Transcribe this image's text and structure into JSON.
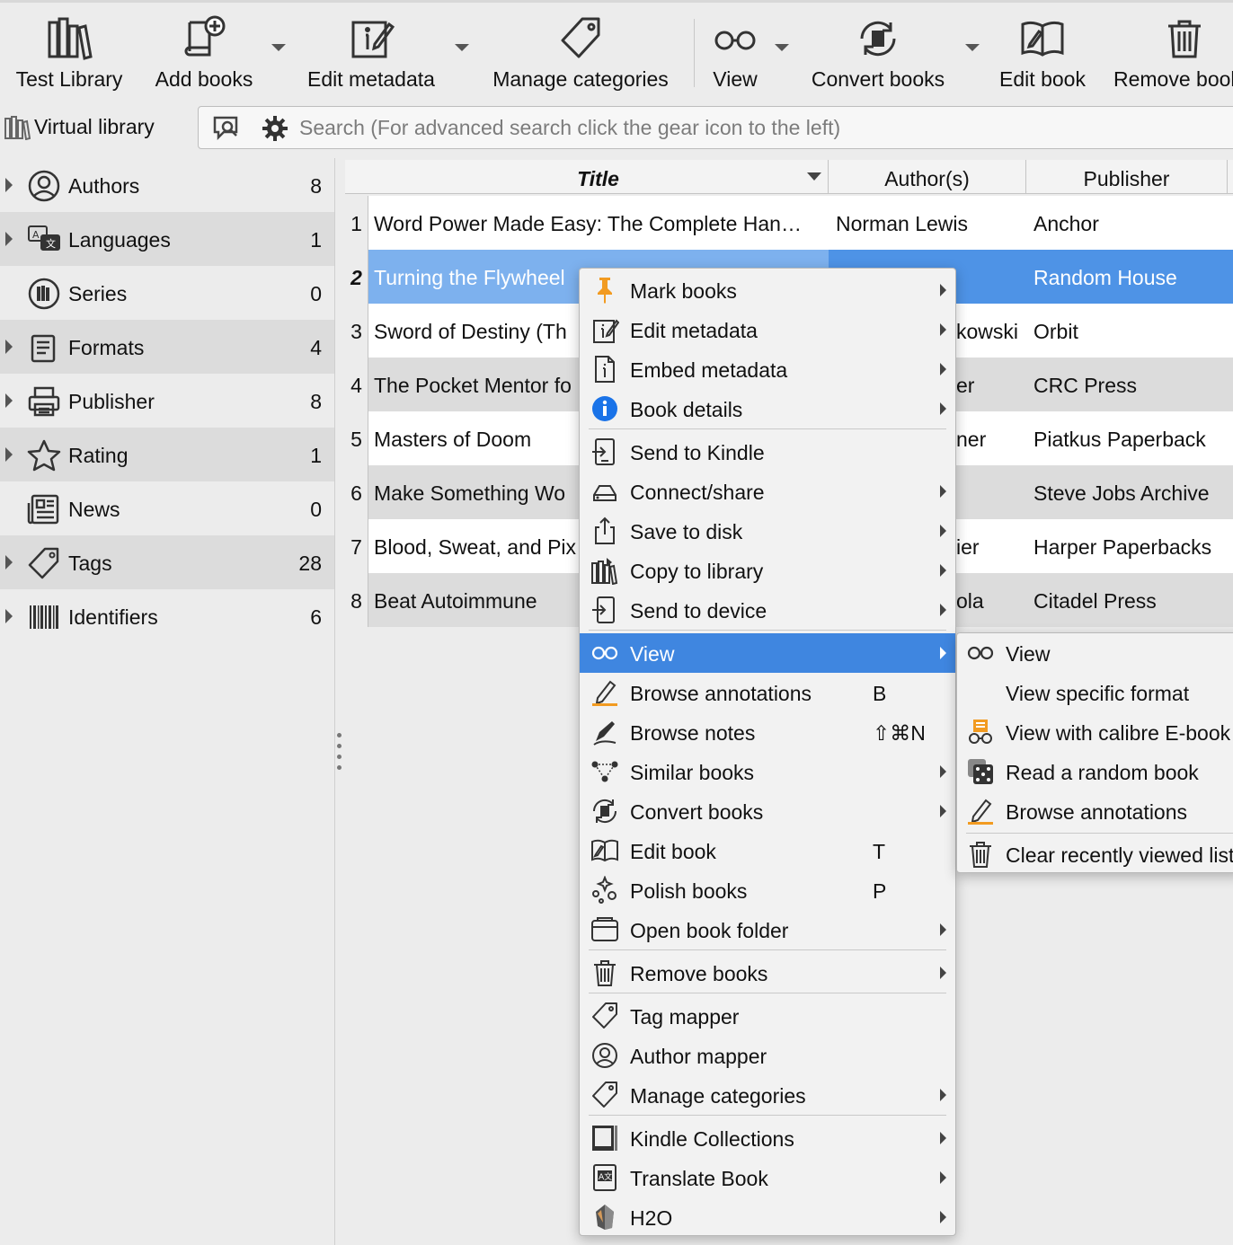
{
  "toolbar": {
    "items": [
      {
        "label": "Test Library",
        "icon": "library-icon"
      },
      {
        "label": "Add books",
        "icon": "add-book-icon"
      },
      {
        "label": "Edit metadata",
        "icon": "edit-metadata-icon"
      },
      {
        "label": "Manage categories",
        "icon": "tag-icon"
      },
      {
        "label": "View",
        "icon": "glasses-icon"
      },
      {
        "label": "Convert books",
        "icon": "convert-icon"
      },
      {
        "label": "Edit book",
        "icon": "edit-book-icon"
      },
      {
        "label": "Remove books",
        "icon": "trash-icon"
      }
    ]
  },
  "search": {
    "virtual_library_label": "Virtual library",
    "placeholder": "Search (For advanced search click the gear icon to the left)"
  },
  "sidebar": {
    "items": [
      {
        "label": "Authors",
        "count": "8",
        "icon": "user-circle-icon"
      },
      {
        "label": "Languages",
        "count": "1",
        "icon": "language-icon"
      },
      {
        "label": "Series",
        "count": "0",
        "icon": "series-icon"
      },
      {
        "label": "Formats",
        "count": "4",
        "icon": "formats-icon"
      },
      {
        "label": "Publisher",
        "count": "8",
        "icon": "publisher-icon"
      },
      {
        "label": "Rating",
        "count": "1",
        "icon": "star-icon"
      },
      {
        "label": "News",
        "count": "0",
        "icon": "news-icon"
      },
      {
        "label": "Tags",
        "count": "28",
        "icon": "tag-icon"
      },
      {
        "label": "Identifiers",
        "count": "6",
        "icon": "barcode-icon"
      }
    ]
  },
  "table": {
    "headers": {
      "title": "Title",
      "authors": "Author(s)",
      "publisher": "Publisher"
    },
    "rows": [
      {
        "num": "1",
        "title": "Word Power Made Easy: The Complete Han…",
        "author": "Norman Lewis",
        "publisher": "Anchor"
      },
      {
        "num": "2",
        "title": "Turning the Flywheel",
        "author": "",
        "publisher": "Random House"
      },
      {
        "num": "3",
        "title": "Sword of Destiny (Th",
        "author": "kowski",
        "publisher": "Orbit"
      },
      {
        "num": "4",
        "title": "The Pocket Mentor fo",
        "author": "er",
        "publisher": "CRC Press"
      },
      {
        "num": "5",
        "title": "Masters of Doom",
        "author": "ner",
        "publisher": "Piatkus Paperback"
      },
      {
        "num": "6",
        "title": "Make Something Wo",
        "author": "",
        "publisher": "Steve Jobs Archive"
      },
      {
        "num": "7",
        "title": "Blood, Sweat, and Pix",
        "author": "ier",
        "publisher": "Harper Paperbacks"
      },
      {
        "num": "8",
        "title": "Beat Autoimmune",
        "author": "ola",
        "publisher": "Citadel Press"
      }
    ]
  },
  "context_menu": {
    "items": [
      {
        "label": "Mark books",
        "shortcut": "",
        "icon": "pin-icon"
      },
      {
        "label": "Edit metadata",
        "shortcut": "",
        "icon": "edit-metadata-icon"
      },
      {
        "label": "Embed metadata",
        "shortcut": "",
        "icon": "embed-metadata-icon"
      },
      {
        "label": "Book details",
        "shortcut": "",
        "icon": "info-icon"
      },
      {
        "label": "Send to Kindle",
        "shortcut": "",
        "icon": "send-to-kindle-icon"
      },
      {
        "label": "Connect/share",
        "shortcut": "",
        "icon": "connect-share-icon"
      },
      {
        "label": "Save to disk",
        "shortcut": "",
        "icon": "save-icon"
      },
      {
        "label": "Copy to library",
        "shortcut": "",
        "icon": "copy-library-icon"
      },
      {
        "label": "Send to device",
        "shortcut": "",
        "icon": "send-device-icon"
      },
      {
        "label": "View",
        "shortcut": "",
        "icon": "glasses-icon"
      },
      {
        "label": "Browse annotations",
        "shortcut": "B",
        "icon": "highlighter-icon"
      },
      {
        "label": "Browse notes",
        "shortcut": "⇧⌘N",
        "icon": "pen-icon"
      },
      {
        "label": "Similar books",
        "shortcut": "",
        "icon": "similar-icon"
      },
      {
        "label": "Convert books",
        "shortcut": "",
        "icon": "convert-icon"
      },
      {
        "label": "Edit book",
        "shortcut": "T",
        "icon": "edit-book-icon"
      },
      {
        "label": "Polish books",
        "shortcut": "P",
        "icon": "polish-icon"
      },
      {
        "label": "Open book folder",
        "shortcut": "",
        "icon": "folder-icon"
      },
      {
        "label": "Remove books",
        "shortcut": "",
        "icon": "trash-icon"
      },
      {
        "label": "Tag mapper",
        "shortcut": "",
        "icon": "tag-icon"
      },
      {
        "label": "Author mapper",
        "shortcut": "",
        "icon": "user-circle-icon"
      },
      {
        "label": "Manage categories",
        "shortcut": "",
        "icon": "tag-icon"
      },
      {
        "label": "Kindle Collections",
        "shortcut": "",
        "icon": "kindle-icon"
      },
      {
        "label": "Translate Book",
        "shortcut": "",
        "icon": "translate-icon"
      },
      {
        "label": "H2O",
        "shortcut": "",
        "icon": "h2o-icon"
      }
    ]
  },
  "view_submenu": {
    "items": [
      {
        "label": "View",
        "icon": "glasses-icon"
      },
      {
        "label": "View specific format",
        "icon": ""
      },
      {
        "label": "View with calibre E-book viewer",
        "icon": "viewer-icon"
      },
      {
        "label": "Read a random book",
        "icon": "dice-icon"
      },
      {
        "label": "Browse annotations",
        "icon": "highlighter-icon"
      },
      {
        "label": "Clear recently viewed list",
        "icon": "trash-icon"
      }
    ]
  },
  "colors": {
    "selection": "#4e93e6",
    "menu_highlight": "#3f86e0",
    "accent_orange": "#f29b21"
  }
}
